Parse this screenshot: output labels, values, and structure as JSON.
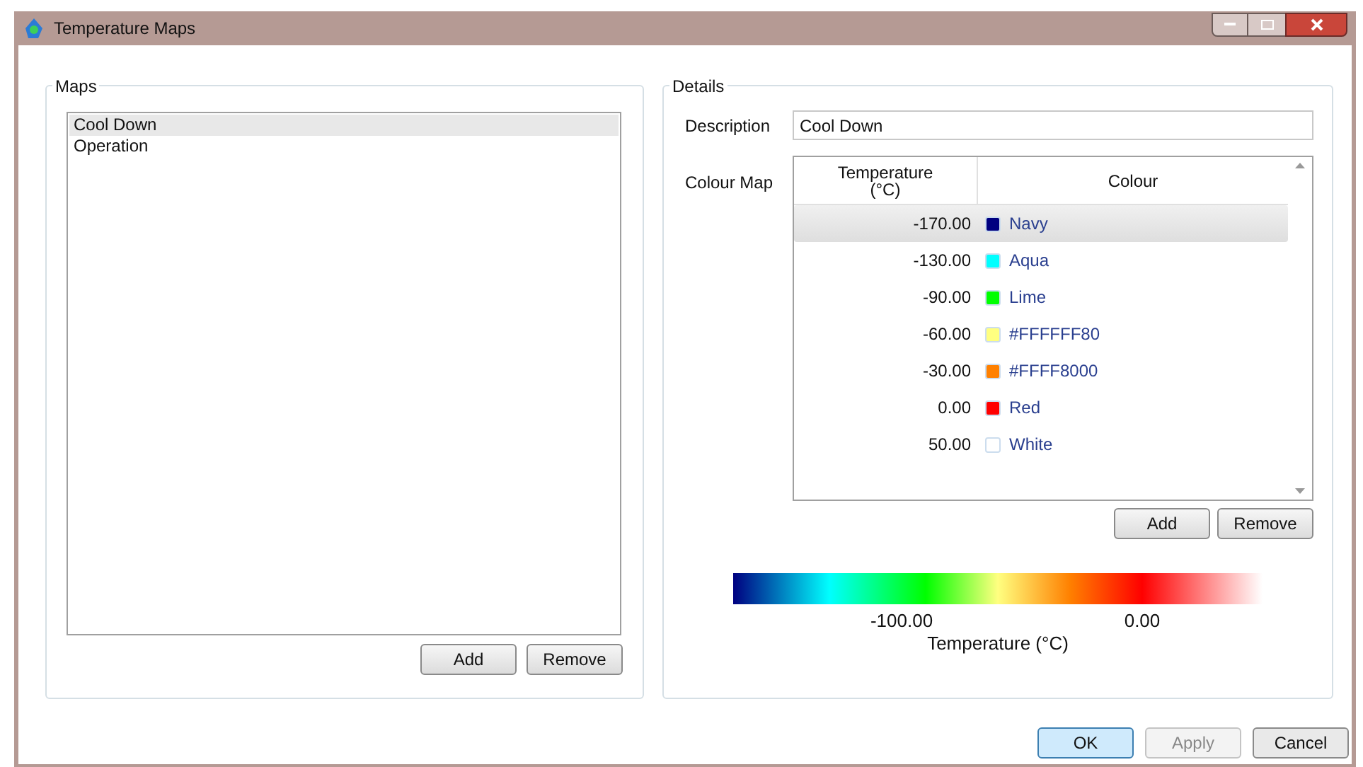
{
  "window": {
    "title": "Temperature Maps"
  },
  "maps": {
    "title": "Maps",
    "items": [
      {
        "label": "Cool Down",
        "selected": true
      },
      {
        "label": "Operation",
        "selected": false
      }
    ],
    "buttons": [
      "Add",
      "Remove"
    ]
  },
  "details": {
    "title": "Details",
    "description_label": "Description",
    "description": "Cool Down",
    "colour_map_label": "Colour Map",
    "columns": [
      "Temperature\n(°C)",
      "Colour"
    ],
    "rows": [
      {
        "temperature": "-170.00",
        "colour": "Navy",
        "color": "#000080",
        "selected": true
      },
      {
        "temperature": "-130.00",
        "colour": "Aqua",
        "color": "#00ffff",
        "selected": false
      },
      {
        "temperature": "-90.00",
        "colour": "Lime",
        "color": "#00ff00",
        "selected": false
      },
      {
        "temperature": "-60.00",
        "colour": "#FFFFFF80",
        "color": "#ffff80",
        "selected": false
      },
      {
        "temperature": "-30.00",
        "colour": "#FFFF8000",
        "color": "#ff8000",
        "selected": false
      },
      {
        "temperature": "0.00",
        "colour": "Red",
        "color": "#ff0000",
        "selected": false
      },
      {
        "temperature": "50.00",
        "colour": "White",
        "color": "#ffffff",
        "selected": false
      }
    ],
    "buttons": [
      "Add",
      "Remove"
    ],
    "colour_bar": {
      "ticks": [
        "-100.00",
        "0.00"
      ],
      "label": "Temperature (°C)"
    }
  },
  "footer_buttons": [
    {
      "label": "OK",
      "kind": "default",
      "disabled": false
    },
    {
      "label": "Apply",
      "kind": "normal",
      "disabled": true
    },
    {
      "label": "Cancel",
      "kind": "normal",
      "disabled": false
    }
  ]
}
